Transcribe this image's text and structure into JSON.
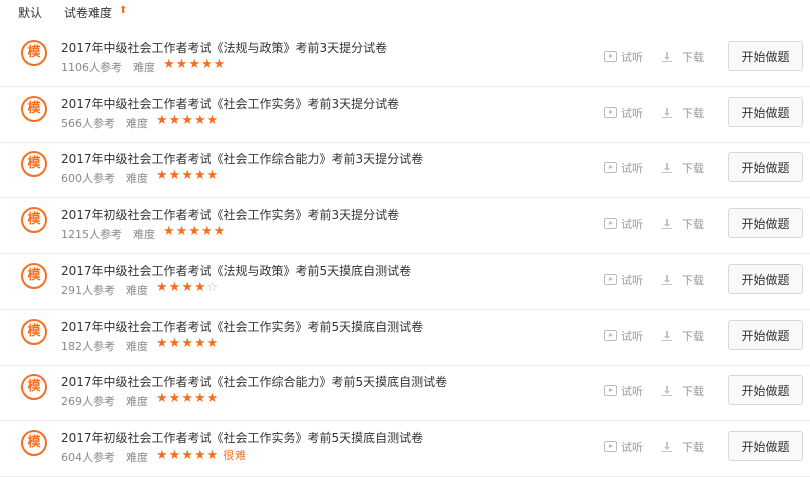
{
  "sort": {
    "default_label": "默认",
    "difficulty_label": "试卷难度",
    "arrow_icon": "sort-up-arrow"
  },
  "colors": {
    "accent": "#f37021",
    "muted": "#888888"
  },
  "common": {
    "difficulty_label": "难度",
    "try_label": "试听",
    "download_label": "下载",
    "start_label": "开始做题",
    "badge_char": "模"
  },
  "papers": [
    {
      "title": "2017年中级社会工作者考试《法规与政策》考前3天提分试卷",
      "participants": "1106人参考",
      "stars": 5,
      "tag": ""
    },
    {
      "title": "2017年中级社会工作者考试《社会工作实务》考前3天提分试卷",
      "participants": "566人参考",
      "stars": 5,
      "tag": ""
    },
    {
      "title": "2017年中级社会工作者考试《社会工作综合能力》考前3天提分试卷",
      "participants": "600人参考",
      "stars": 5,
      "tag": ""
    },
    {
      "title": "2017年初级社会工作者考试《社会工作实务》考前3天提分试卷",
      "participants": "1215人参考",
      "stars": 5,
      "tag": ""
    },
    {
      "title": "2017年中级社会工作者考试《法规与政策》考前5天摸底自测试卷",
      "participants": "291人参考",
      "stars": 4,
      "tag": ""
    },
    {
      "title": "2017年中级社会工作者考试《社会工作实务》考前5天摸底自测试卷",
      "participants": "182人参考",
      "stars": 5,
      "tag": ""
    },
    {
      "title": "2017年中级社会工作者考试《社会工作综合能力》考前5天摸底自测试卷",
      "participants": "269人参考",
      "stars": 5,
      "tag": ""
    },
    {
      "title": "2017年初级社会工作者考试《社会工作实务》考前5天摸底自测试卷",
      "participants": "604人参考",
      "stars": 5,
      "tag": "很难"
    }
  ]
}
